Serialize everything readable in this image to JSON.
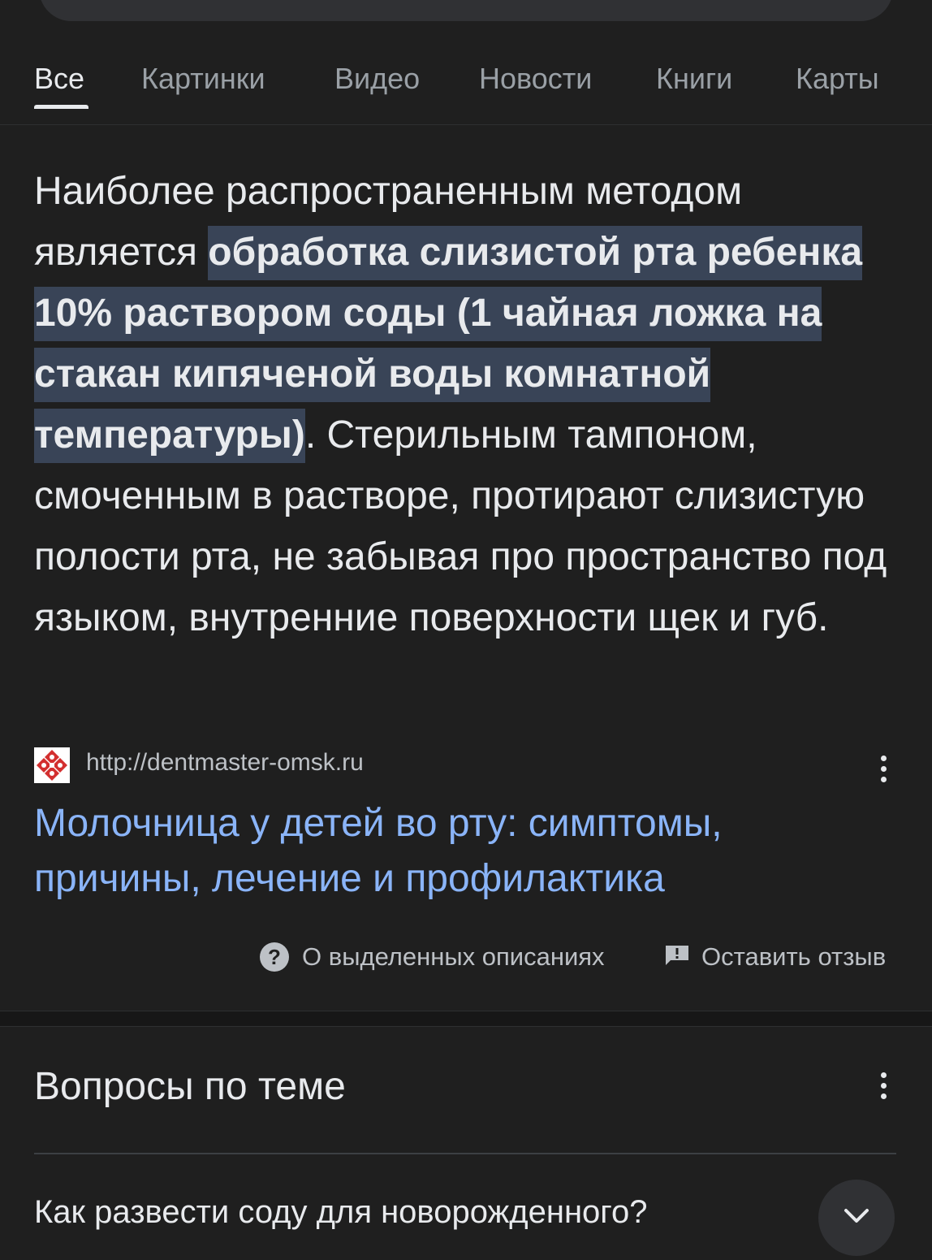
{
  "tabs": [
    {
      "label": "Все",
      "active": true
    },
    {
      "label": "Картинки"
    },
    {
      "label": "Видео"
    },
    {
      "label": "Новости"
    },
    {
      "label": "Книги"
    },
    {
      "label": "Карты"
    }
  ],
  "snippet": {
    "text_before": "Наиболее распространенным методом является ",
    "highlighted": "обработка слизистой рта ребенка 10% раствором соды (1 чайная ложка на стакан кипяченой воды комнатной температуры)",
    "text_after": ". Стерильным тампоном, смоченным в растворе, протирают слизистую полости рта, не забывая про пространство под языком, внутренние поверхности щек и губ."
  },
  "source": {
    "url": "http://dentmaster-omsk.ru",
    "favicon": "dentmaster-logo-icon"
  },
  "result": {
    "title": "Молочница у детей во рту: симптомы, причины, лечение и профилактика"
  },
  "footer": {
    "about_label": "О выделенных описаниях",
    "about_icon": "help-circle-icon",
    "feedback_label": "Оставить отзыв",
    "feedback_icon": "feedback-icon"
  },
  "related": {
    "title": "Вопросы по теме",
    "first_question": "Как развести соду для новорожденного?",
    "expand_icon": "chevron-down-icon"
  },
  "colors": {
    "background": "#1f1f1f",
    "text": "#e8eaed",
    "highlight_bg": "#394457",
    "link": "#8ab4f8",
    "muted": "#9aa0a6"
  }
}
